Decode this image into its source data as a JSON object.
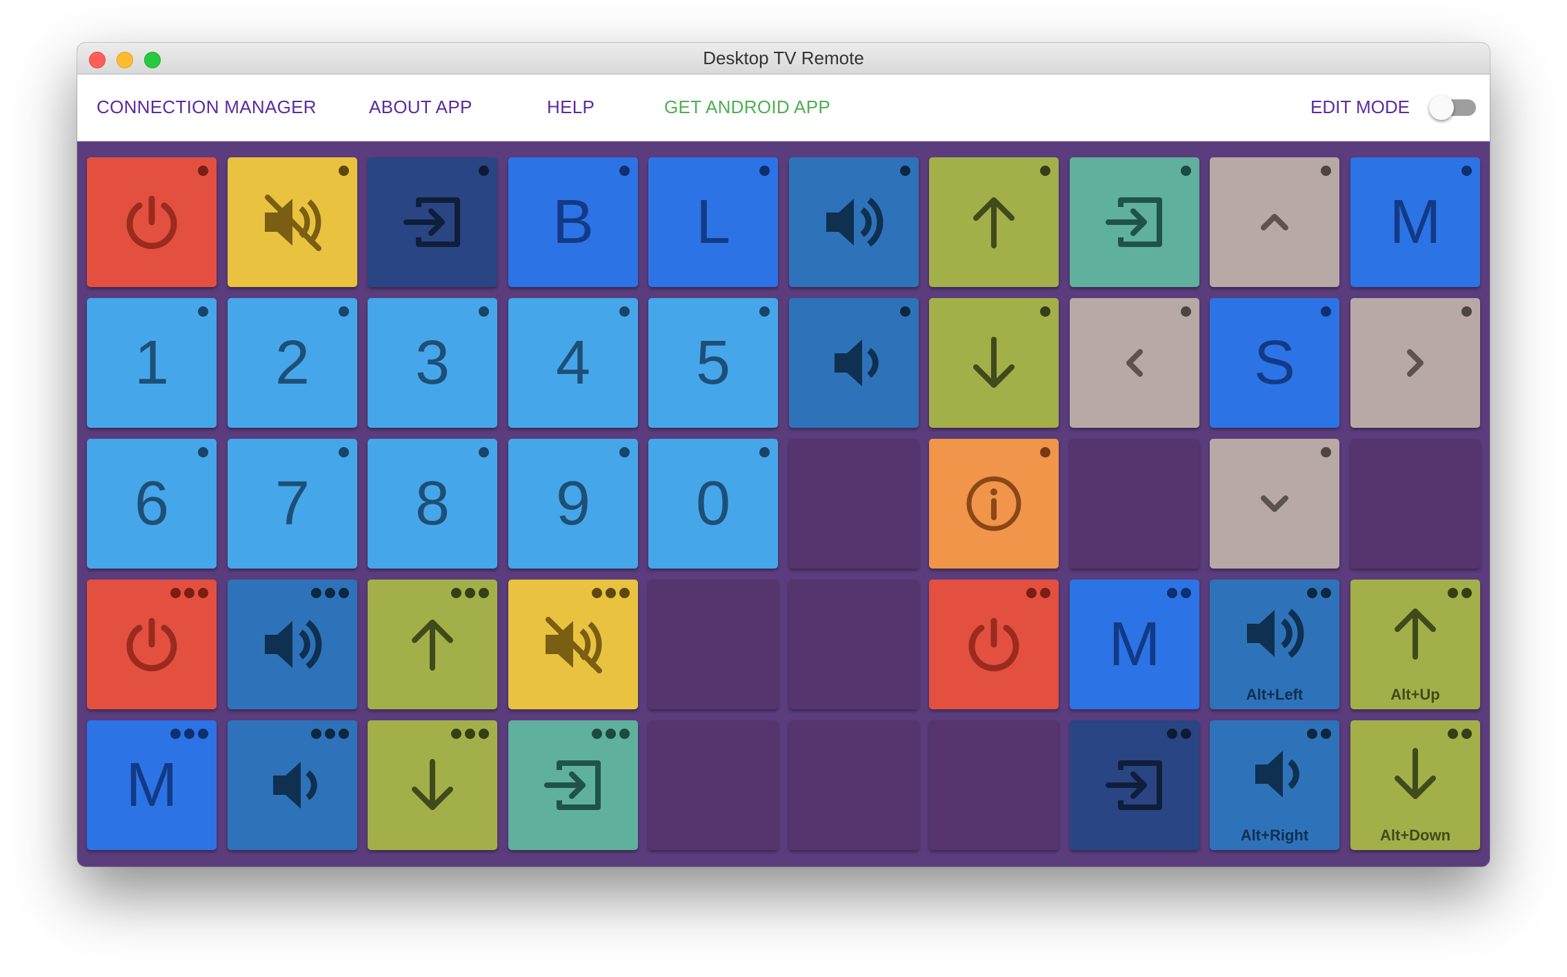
{
  "window": {
    "title": "Desktop TV Remote"
  },
  "menu": {
    "connection_manager": "CONNECTION MANAGER",
    "about_app": "ABOUT APP",
    "help": "HELP",
    "get_android_app": "GET ANDROID APP",
    "edit_mode": "EDIT MODE",
    "edit_mode_on": false
  },
  "colors": {
    "background": "#5b3d7d",
    "empty_tile": "#56356f",
    "red": "#e35040",
    "yellow": "#e9c240",
    "navy": "#294583",
    "blue": "#2c73e5",
    "steel": "#2e73ba",
    "olive": "#a3b04a",
    "teal": "#5fb09c",
    "taupe": "#b8a9a6",
    "light_blue": "#46a6ea",
    "orange": "#f0954a"
  },
  "tiles": [
    [
      {
        "color": "red",
        "icon": "power-icon",
        "dots": 1
      },
      {
        "color": "yellow",
        "icon": "mute-icon",
        "dots": 1
      },
      {
        "color": "navy",
        "icon": "input-icon",
        "dots": 1
      },
      {
        "color": "blue",
        "label": "B",
        "dots": 1
      },
      {
        "color": "blue",
        "label": "L",
        "dots": 1
      },
      {
        "color": "steel",
        "icon": "volume-up-icon",
        "dots": 1
      },
      {
        "color": "olive",
        "icon": "arrow-up-icon",
        "dots": 1
      },
      {
        "color": "teal",
        "icon": "input-icon",
        "dots": 1
      },
      {
        "color": "taupe",
        "icon": "chevron-up-icon",
        "dots": 1
      },
      {
        "color": "blue",
        "label": "M",
        "dots": 1
      }
    ],
    [
      {
        "color": "light_blue",
        "label": "1",
        "dots": 1
      },
      {
        "color": "light_blue",
        "label": "2",
        "dots": 1
      },
      {
        "color": "light_blue",
        "label": "3",
        "dots": 1
      },
      {
        "color": "light_blue",
        "label": "4",
        "dots": 1
      },
      {
        "color": "light_blue",
        "label": "5",
        "dots": 1
      },
      {
        "color": "steel",
        "icon": "volume-down-icon",
        "dots": 1
      },
      {
        "color": "olive",
        "icon": "arrow-down-icon",
        "dots": 1
      },
      {
        "color": "taupe",
        "icon": "chevron-left-icon",
        "dots": 1
      },
      {
        "color": "blue",
        "label": "S",
        "dots": 1
      },
      {
        "color": "taupe",
        "icon": "chevron-right-icon",
        "dots": 1
      }
    ],
    [
      {
        "color": "light_blue",
        "label": "6",
        "dots": 1
      },
      {
        "color": "light_blue",
        "label": "7",
        "dots": 1
      },
      {
        "color": "light_blue",
        "label": "8",
        "dots": 1
      },
      {
        "color": "light_blue",
        "label": "9",
        "dots": 1
      },
      {
        "color": "light_blue",
        "label": "0",
        "dots": 1
      },
      {
        "empty": true
      },
      {
        "color": "orange",
        "icon": "info-icon",
        "dots": 1
      },
      {
        "empty": true
      },
      {
        "color": "taupe",
        "icon": "chevron-down-icon",
        "dots": 1
      },
      {
        "empty": true
      }
    ],
    [
      {
        "color": "red",
        "icon": "power-icon",
        "dots": 3
      },
      {
        "color": "steel",
        "icon": "volume-up-icon",
        "dots": 3
      },
      {
        "color": "olive",
        "icon": "arrow-up-icon",
        "dots": 3
      },
      {
        "color": "yellow",
        "icon": "mute-icon",
        "dots": 3
      },
      {
        "empty": true
      },
      {
        "empty": true
      },
      {
        "color": "red",
        "icon": "power-icon",
        "dots": 2
      },
      {
        "color": "blue",
        "label": "M",
        "dots": 2
      },
      {
        "color": "steel",
        "icon": "volume-up-icon",
        "dots": 2,
        "sub": "Alt+Left"
      },
      {
        "color": "olive",
        "icon": "arrow-up-icon",
        "dots": 2,
        "sub": "Alt+Up"
      }
    ],
    [
      {
        "color": "blue",
        "label": "M",
        "dots": 3
      },
      {
        "color": "steel",
        "icon": "volume-down-icon",
        "dots": 3
      },
      {
        "color": "olive",
        "icon": "arrow-down-icon",
        "dots": 3
      },
      {
        "color": "teal",
        "icon": "input-icon",
        "dots": 3
      },
      {
        "empty": true
      },
      {
        "empty": true
      },
      {
        "empty": true
      },
      {
        "color": "navy",
        "icon": "input-icon",
        "dots": 2
      },
      {
        "color": "steel",
        "icon": "volume-down-icon",
        "dots": 2,
        "sub": "Alt+Right"
      },
      {
        "color": "olive",
        "icon": "arrow-down-icon",
        "dots": 2,
        "sub": "Alt+Down"
      }
    ]
  ]
}
